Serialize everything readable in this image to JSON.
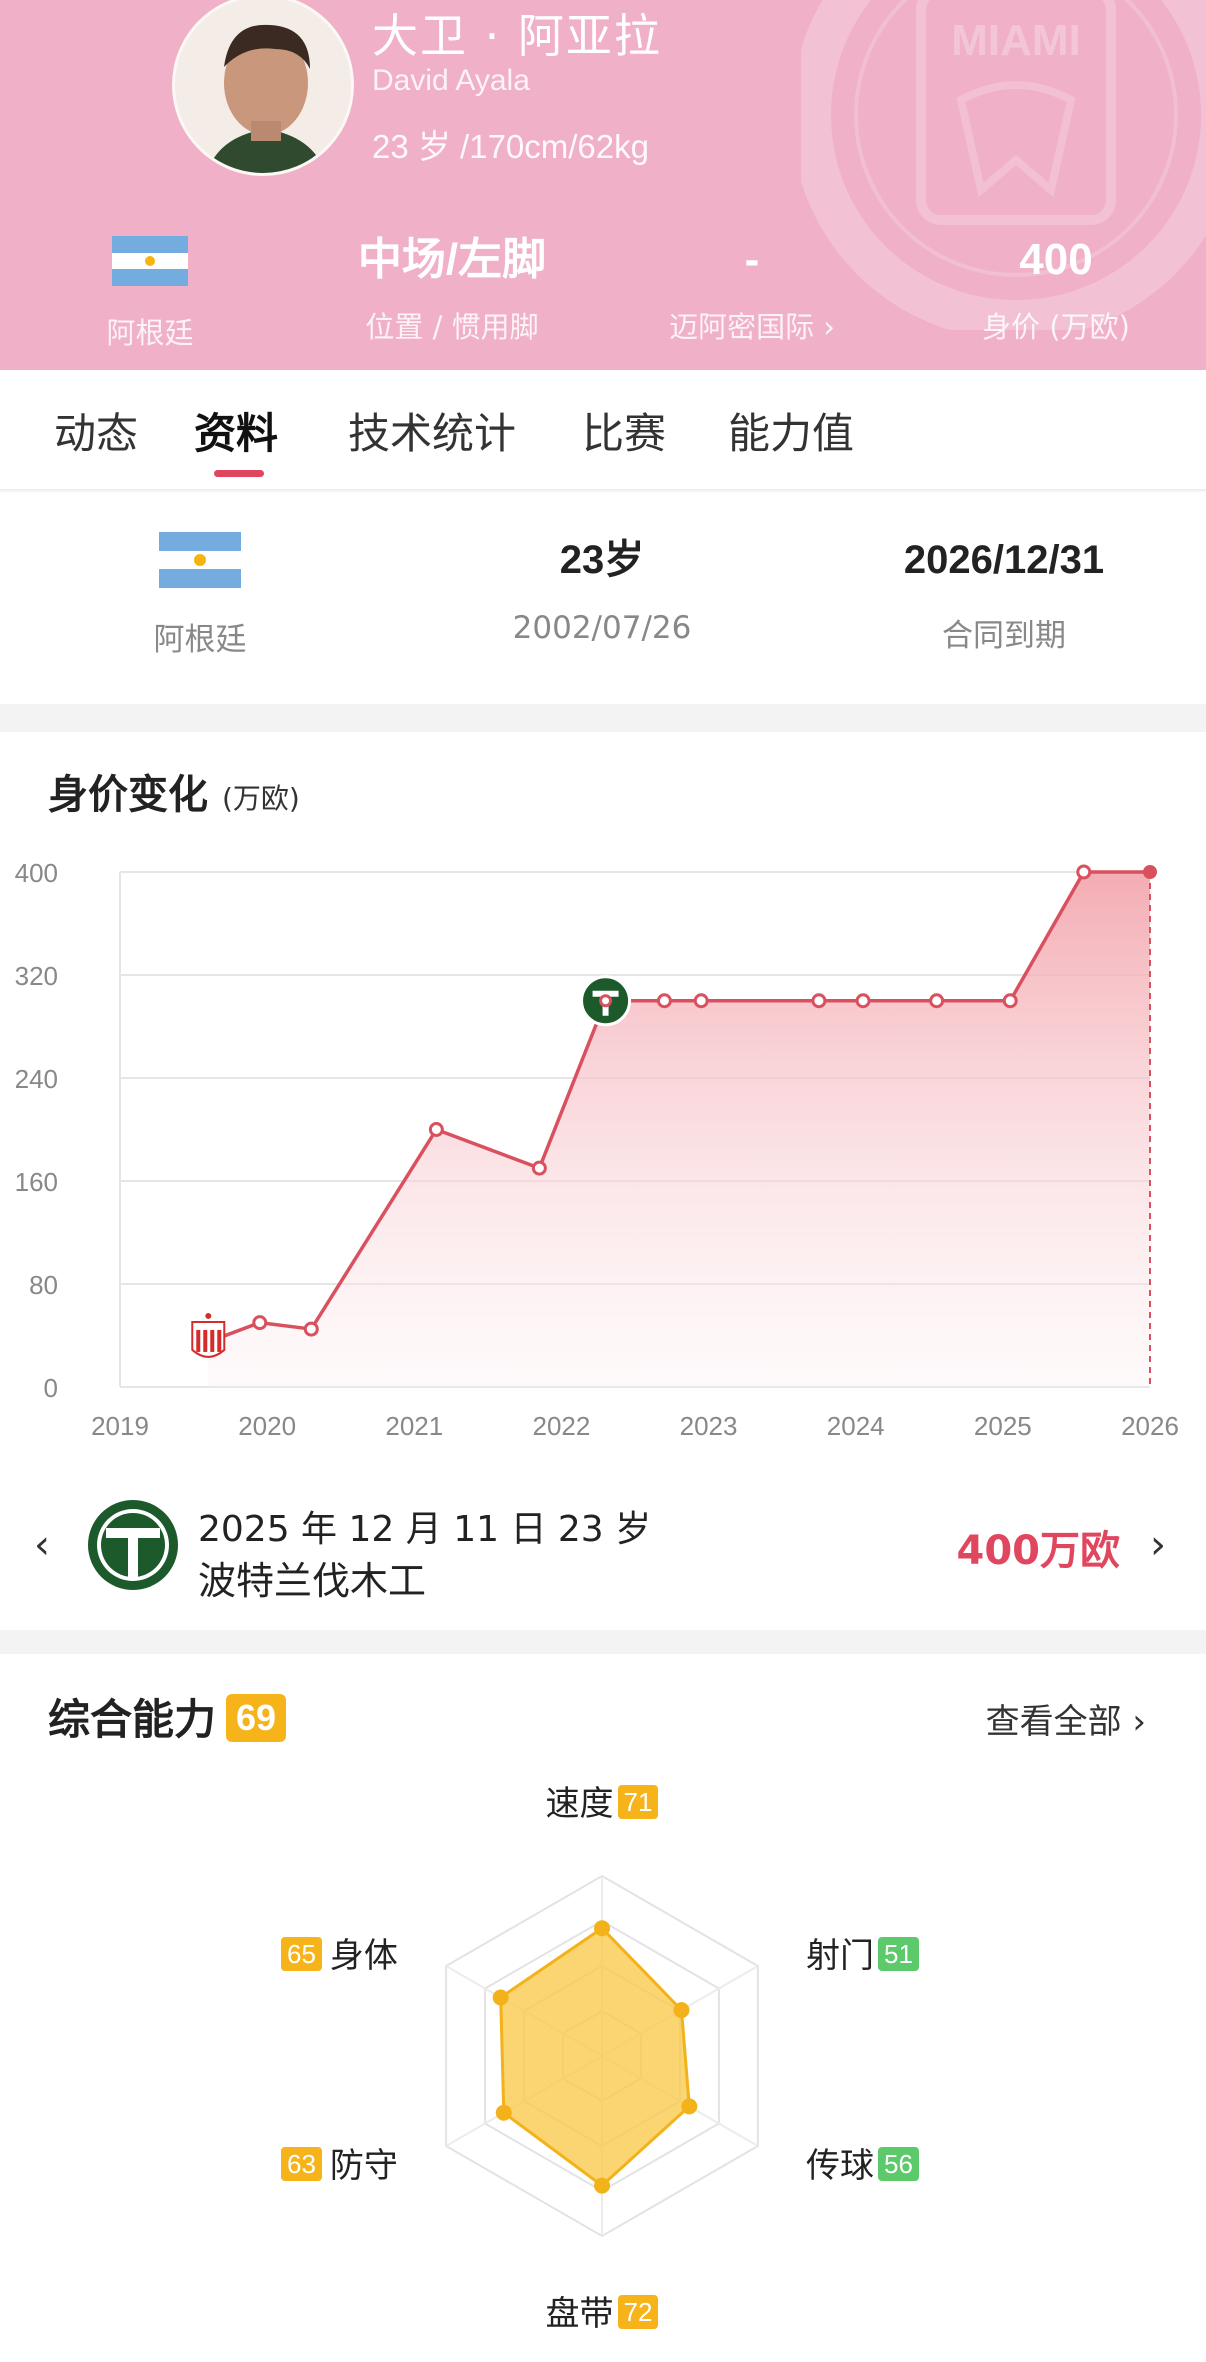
{
  "player": {
    "name_cn": "大卫 · 阿亚拉",
    "name_en": "David Ayala",
    "bio": "23 岁 /170cm/62kg"
  },
  "header_stats": [
    {
      "value": "",
      "label": "阿根廷",
      "icon": "argentina-flag-icon"
    },
    {
      "value": "中场/左脚",
      "label": "位置 / 惯用脚"
    },
    {
      "value": "-",
      "label": "迈阿密国际 ›"
    },
    {
      "value": "400",
      "label": "身价 (万欧)"
    }
  ],
  "crest_text": "MIAMI",
  "tabs": [
    "动态",
    "资料",
    "技术统计",
    "比赛",
    "能力值"
  ],
  "active_tab": "资料",
  "info": [
    {
      "value": "",
      "label": "阿根廷",
      "icon": "argentina-flag-icon"
    },
    {
      "value": "23岁",
      "label": "2002/07/26"
    },
    {
      "value": "2026/12/31",
      "label": "合同到期"
    }
  ],
  "value_chart": {
    "title": "身价变化",
    "unit": "(万欧)"
  },
  "chart_data": {
    "type": "area",
    "title": "身价变化",
    "ylabel": "(万欧)",
    "xlabel": "",
    "ylim": [
      0,
      400
    ],
    "xlim": [
      2019,
      2026
    ],
    "y_ticks": [
      0,
      80,
      160,
      240,
      320,
      400
    ],
    "x_ticks": [
      2019,
      2020,
      2021,
      2022,
      2023,
      2024,
      2025,
      2026
    ],
    "grid": true,
    "line_color": "#d9505f",
    "series": [
      {
        "points": [
          {
            "x": 2019.6,
            "y": 35,
            "club": "estudiantes-logo"
          },
          {
            "x": 2019.95,
            "y": 50
          },
          {
            "x": 2020.3,
            "y": 45
          },
          {
            "x": 2021.15,
            "y": 200
          },
          {
            "x": 2021.85,
            "y": 170
          },
          {
            "x": 2022.3,
            "y": 300,
            "club": "timbers-logo"
          },
          {
            "x": 2022.7,
            "y": 300
          },
          {
            "x": 2022.95,
            "y": 300
          },
          {
            "x": 2023.75,
            "y": 300
          },
          {
            "x": 2024.05,
            "y": 300
          },
          {
            "x": 2024.55,
            "y": 300
          },
          {
            "x": 2025.05,
            "y": 300
          },
          {
            "x": 2025.55,
            "y": 400
          },
          {
            "x": 2026.0,
            "y": 400
          }
        ]
      }
    ]
  },
  "latest_transfer": {
    "date": "2025 年 12 月 11 日  23 岁",
    "club": "波特兰伐木工",
    "value": "400万欧",
    "prev_arrow": "‹",
    "next_arrow": "›"
  },
  "ability": {
    "title": "综合能力",
    "overall": "69",
    "view_all": "查看全部 ›",
    "attributes": [
      {
        "label": "速度",
        "value": 71,
        "badge": "yellow"
      },
      {
        "label": "射门",
        "value": 51,
        "badge": "green"
      },
      {
        "label": "传球",
        "value": 56,
        "badge": "green"
      },
      {
        "label": "盘带",
        "value": 72,
        "badge": "yellow"
      },
      {
        "label": "防守",
        "value": 63,
        "badge": "yellow"
      },
      {
        "label": "身体",
        "value": 65,
        "badge": "yellow"
      }
    ],
    "fill_color": "#f9c94a",
    "stroke_color": "#f3b21a"
  }
}
